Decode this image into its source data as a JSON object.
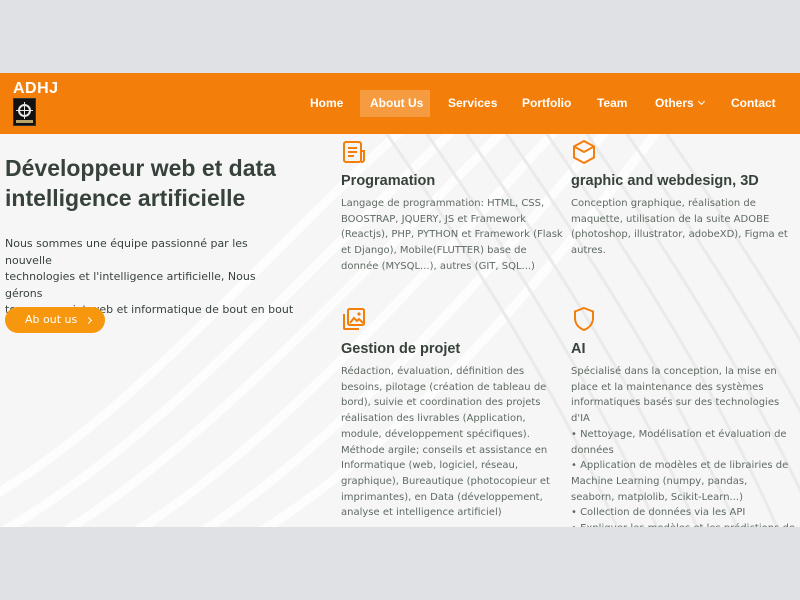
{
  "brand": {
    "name": "ADHJ",
    "logo_icon": "adhj-logo"
  },
  "nav": {
    "home": "Home",
    "about": "About Us",
    "services": "Services",
    "portfolio": "Portfolio",
    "team": "Team",
    "others": "Others",
    "contact": "Contact"
  },
  "hero": {
    "title_line1": "Développeur web et data",
    "title_line2": "intelligence artificielle",
    "desc_line1": "Nous sommes une équipe passionné par les nouvelle",
    "desc_line2": "technologies et l'intelligence artificielle, Nous gérons",
    "desc_line3": "tous vos projet web et informatique de bout en bout",
    "button_label": "Ab out us"
  },
  "services": [
    {
      "icon": "document-icon",
      "title": "Programation",
      "lines": [
        "Langage de programmation: HTML, CSS,",
        "BOOSTRAP, JQUERY, JS et Framework",
        "(Reactjs), PHP, PYTHON et Framework (Flask",
        "et Django), Mobile(FLUTTER) base de",
        "donnée (MYSQL...), autres (GIT, SQL...)"
      ]
    },
    {
      "icon": "cube-icon",
      "title": "graphic and webdesign, 3D",
      "lines": [
        "Conception graphique, réalisation de",
        "maquette, utilisation de la suite ADOBE",
        "(photoshop, illustrator, adobeXD), Figma et",
        "autres."
      ]
    },
    {
      "icon": "images-icon",
      "title": "Gestion de projet",
      "lines": [
        "Rédaction, évaluation, définition des",
        "besoins, pilotage (création de tableau de",
        "bord), suivie et coordination des projets",
        "réalisation des livrables (Application,",
        "module, développement spécifiques).",
        "Méthode argile; conseils et assistance en",
        "Informatique (web, logiciel, réseau,",
        "graphique), Bureautique (photocopieur et",
        "imprimantes), en Data (développement,",
        "analyse et intelligence artificiel)"
      ]
    },
    {
      "icon": "shield-icon",
      "title": "AI",
      "lines": [
        "Spécialisé dans la conception, la mise en",
        "place et la maintenance des systèmes",
        "informatiques basés sur des technologies",
        "d'IA",
        "• Nettoyage, Modélisation et évaluation de",
        "données",
        "• Application de modèles et de librairies de",
        "Machine Learning (numpy, pandas,",
        "seaborn, matplolib, Scikit-Learn...)",
        "• Collection de données via les API",
        "• Expliquer les modèles et les prédictions de"
      ]
    }
  ],
  "colors": {
    "accent": "#f47e0a",
    "active_tab": "#f79b41",
    "button": "#f7970d",
    "heading": "#37423b",
    "text": "#5f6b63"
  }
}
